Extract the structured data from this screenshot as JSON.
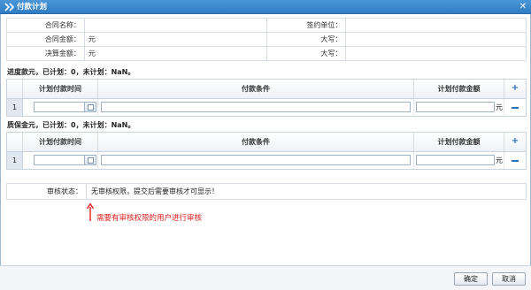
{
  "window": {
    "title": "付款计划",
    "close_glyph": "✕"
  },
  "contract_info": {
    "rows": [
      {
        "left_label": "合同名称：",
        "left_value": "",
        "right_label": "签约单位：",
        "right_value": ""
      },
      {
        "left_label": "合同金额：",
        "left_value": "元",
        "right_label": "大写：",
        "right_value": ""
      },
      {
        "left_label": "决算金额：",
        "left_value": "元",
        "right_label": "大写：",
        "right_value": ""
      }
    ]
  },
  "progress_section": {
    "summary": "进度款元，已计划：0，未计划：NaN。",
    "columns": [
      "计划付款时间",
      "付款条件",
      "计划付款金额"
    ],
    "row": {
      "number": "1",
      "date": "",
      "condition": "",
      "amount": "",
      "unit": "元"
    },
    "add_glyph": "+"
  },
  "retention_section": {
    "summary": "质保金元，已计划：0，未计划：NaN。",
    "columns": [
      "计划付款时间",
      "付款条件",
      "计划付款金额"
    ],
    "row": {
      "number": "1",
      "date": "",
      "condition": "",
      "amount": "",
      "unit": "元"
    },
    "add_glyph": "+"
  },
  "audit": {
    "label": "审核状态：",
    "value": "无审核权限，提交后需要审核才可显示！"
  },
  "annotation": {
    "text": "需要有审核权限的用户进行审核",
    "color": "#e02020"
  },
  "footer": {
    "confirm_label": "确定",
    "cancel_label": "取消"
  }
}
